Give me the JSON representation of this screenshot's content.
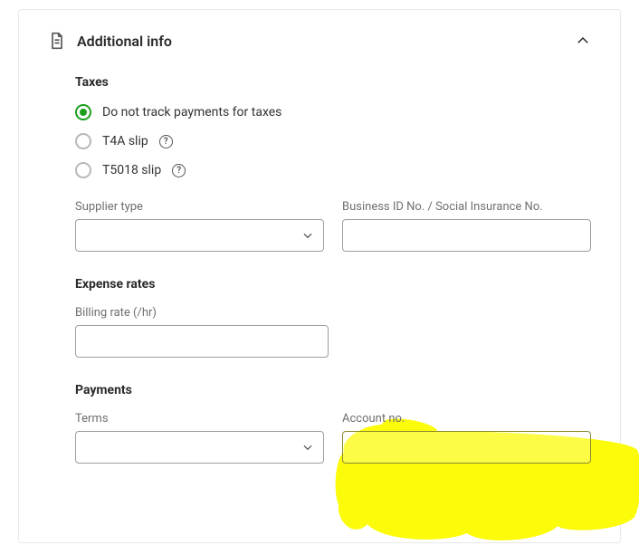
{
  "panel": {
    "title": "Additional info"
  },
  "taxes": {
    "heading": "Taxes",
    "options": [
      {
        "label": "Do not track payments for taxes"
      },
      {
        "label": "T4A slip"
      },
      {
        "label": "T5018 slip"
      }
    ],
    "supplier_type_label": "Supplier type",
    "business_id_label": "Business ID No. / Social Insurance No."
  },
  "expense": {
    "heading": "Expense rates",
    "billing_rate_label": "Billing rate (/hr)"
  },
  "payments": {
    "heading": "Payments",
    "terms_label": "Terms",
    "account_no_label": "Account no."
  }
}
